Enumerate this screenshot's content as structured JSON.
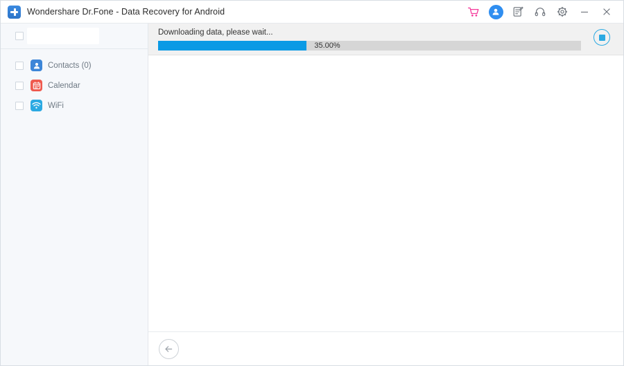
{
  "window": {
    "title": "Wondershare Dr.Fone - Data Recovery for Android",
    "logo_icon": "drfone-plus-logo-icon",
    "titlebar_icons": [
      {
        "name": "cart-icon",
        "label": "Store",
        "color": "#f5399b"
      },
      {
        "name": "account-avatar-icon",
        "label": "Account",
        "color": "#2f8ef0"
      },
      {
        "name": "feedback-icon",
        "label": "Feedback",
        "color": "#6b7179"
      },
      {
        "name": "support-headset-icon",
        "label": "Support",
        "color": "#6b7179"
      },
      {
        "name": "settings-gear-icon",
        "label": "Settings",
        "color": "#6b7179"
      },
      {
        "name": "minimize-icon",
        "label": "Minimize",
        "color": "#6b7179"
      },
      {
        "name": "close-icon",
        "label": "Close",
        "color": "#6b7179"
      }
    ]
  },
  "sidebar": {
    "select_all": {
      "label": "",
      "checked": false
    },
    "items": [
      {
        "label": "Contacts (0)",
        "icon": "contacts-icon",
        "color": "#3d86d8",
        "checked": false
      },
      {
        "label": "Calendar",
        "icon": "calendar-icon",
        "color": "#ef5a4f",
        "checked": false
      },
      {
        "label": "WiFi",
        "icon": "wifi-icon",
        "color": "#2aa9e2",
        "checked": false
      }
    ]
  },
  "progress": {
    "status_text": "Downloading data, please wait...",
    "percent_label": "35.00%",
    "percent_value": 35,
    "fill_color": "#0a9ae5",
    "track_color": "#d6d6d6",
    "stop_button": {
      "name": "stop-button",
      "color": "#2aa9e2"
    }
  },
  "footer": {
    "back_button": {
      "name": "back-button",
      "icon": "arrow-left-icon"
    }
  }
}
